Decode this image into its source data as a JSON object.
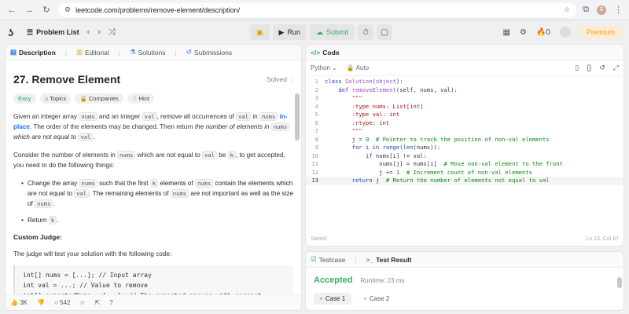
{
  "browser": {
    "url": "leetcode.com/problems/remove-element/description/",
    "avatar_letter": "S"
  },
  "toolbar": {
    "problem_list": "Problem List",
    "run": "Run",
    "submit": "Submit",
    "streak_count": "0",
    "premium": "Premium"
  },
  "left_tabs": [
    "Description",
    "Editorial",
    "Solutions",
    "Submissions"
  ],
  "problem": {
    "title": "27. Remove Element",
    "status": "Solved",
    "tags": [
      "Easy",
      "Topics",
      "Companies",
      "Hint"
    ],
    "p1_a": "Given an integer array ",
    "p1_code1": "nums",
    "p1_b": " and an integer ",
    "p1_code2": "val",
    "p1_c": ", remove all occurrences of ",
    "p1_code3": "val",
    "p1_d": " in ",
    "p1_code4": "nums",
    "p1_bold": "in-place",
    "p1_e": ". The order of the elements may be changed. Then return ",
    "p1_italic": "the number of elements in",
    "p1_code5": "nums",
    "p1_italic2": "which are not equal to",
    "p1_code6": "val",
    "p2_a": "Consider the number of elements in ",
    "p2_code1": "nums",
    "p2_b": " which are not equal to ",
    "p2_code2": "val",
    "p2_c": " be ",
    "p2_code3": "k",
    "p2_d": ", to get accepted, you need to do the following things:",
    "li1_a": "Change the array ",
    "li1_code1": "nums",
    "li1_b": " such that the first ",
    "li1_code2": "k",
    "li1_c": " elements of ",
    "li1_code3": "nums",
    "li1_d": " contain the elements which are not equal to ",
    "li1_code4": "val",
    "li1_e": ". The remaining elements of ",
    "li1_code5": "nums",
    "li1_f": " are not important as well as the size of ",
    "li1_code6": "nums",
    "li1_g": ".",
    "li2_a": "Return ",
    "li2_code": "k",
    "li2_b": ".",
    "judge_heading": "Custom Judge:",
    "judge_text": "The judge will test your solution with the following code:",
    "judge_code": "int[] nums = [...]; // Input array\nint val = ...; // Value to remove\nint[] expectedNums = [...]; // The expected answer with correct\nlength."
  },
  "footer": {
    "likes": "3K",
    "comments": "542"
  },
  "code_panel": {
    "tab": "Code",
    "language": "Python",
    "mode": "Auto",
    "saved": "Saved",
    "cursor": "Ln 13, Col 67"
  },
  "result_panel": {
    "tabs": [
      "Testcase",
      "Test Result"
    ],
    "status": "Accepted",
    "runtime": "Runtime: 23 ms",
    "cases": [
      "Case 1",
      "Case 2"
    ]
  }
}
